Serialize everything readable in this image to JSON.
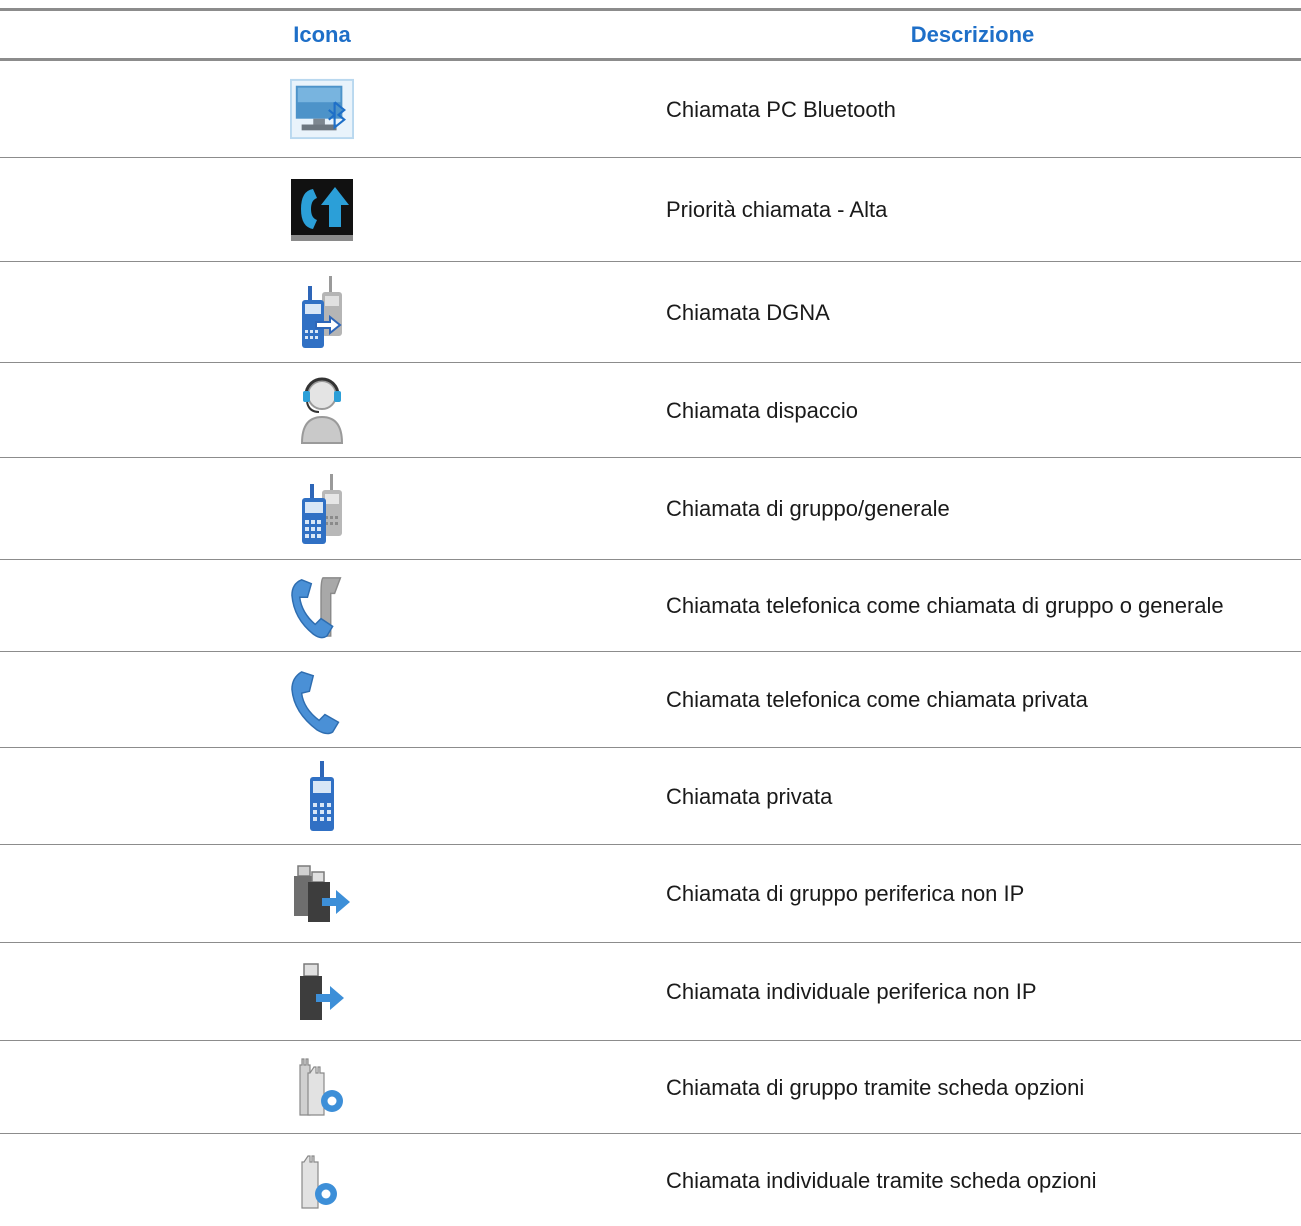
{
  "table": {
    "headers": {
      "icon": "Icona",
      "description": "Descrizione"
    },
    "rows": [
      {
        "icon": "bluetooth-pc-call-icon",
        "description": "Chiamata PC Bluetooth"
      },
      {
        "icon": "call-priority-high-icon",
        "description": "Priorità chiamata - Alta"
      },
      {
        "icon": "dgna-call-icon",
        "description": "Chiamata DGNA"
      },
      {
        "icon": "dispatch-call-icon",
        "description": "Chiamata dispaccio"
      },
      {
        "icon": "group-call-icon",
        "description": "Chiamata di gruppo/generale"
      },
      {
        "icon": "phone-group-call-icon",
        "description": "Chiamata telefonica come chiamata di gruppo o generale"
      },
      {
        "icon": "phone-private-call-icon",
        "description": "Chiamata telefonica come chiamata privata"
      },
      {
        "icon": "private-call-icon",
        "description": "Chiamata privata"
      },
      {
        "icon": "non-ip-peripheral-group-call-icon",
        "description": "Chiamata di gruppo periferica non IP"
      },
      {
        "icon": "non-ip-peripheral-individual-call-icon",
        "description": "Chiamata individuale periferica non IP"
      },
      {
        "icon": "option-board-group-call-icon",
        "description": "Chiamata di gruppo tramite scheda opzioni"
      },
      {
        "icon": "option-board-individual-call-icon",
        "description": "Chiamata individuale tramite scheda opzioni"
      }
    ]
  },
  "colors": {
    "header_text": "#1e6fc8",
    "rule": "#8c8c8c",
    "icon_blue": "#3d8fd8",
    "icon_gray": "#a8a8a8"
  }
}
